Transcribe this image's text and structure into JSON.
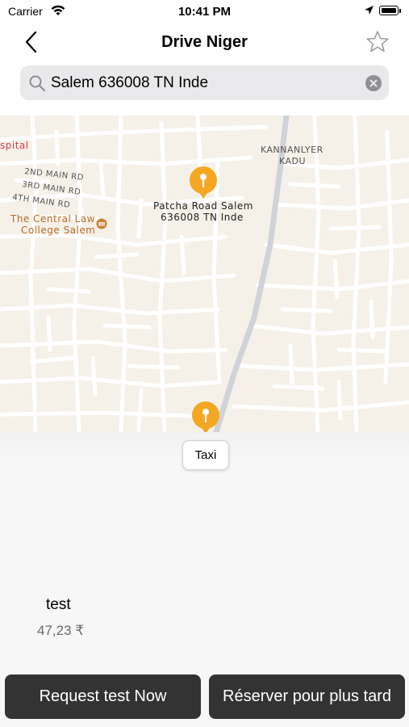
{
  "status_bar": {
    "carrier": "Carrier",
    "time": "10:41 PM"
  },
  "nav": {
    "title": "Drive Niger"
  },
  "search": {
    "value": "Salem 636008 TN Inde"
  },
  "map": {
    "labels": {
      "hospital": "spital",
      "main2": "2ND MAIN RD",
      "main3": "3RD MAIN RD",
      "main4": "4TH MAIN RD",
      "college_line1": "The Central Law",
      "college_line2": "College Salem",
      "area_line1": "KANNANLYER",
      "area_line2": "KADU",
      "pin_line1": "Patcha Road Salem",
      "pin_line2": "636008 TN Inde"
    },
    "colors": {
      "pin": "#f5a623",
      "road": "#ffffff",
      "land": "#f5f1e8",
      "highway": "#cfd2d6"
    }
  },
  "service": {
    "chip_label": "Taxi",
    "name": "test",
    "price": "47,23 ₹"
  },
  "actions": {
    "request_now": "Request test Now",
    "reserve_later": "Réserver pour plus tard"
  },
  "icons": [
    "wifi-icon",
    "location-arrow-icon",
    "battery-icon",
    "back-chevron-icon",
    "star-icon",
    "search-icon",
    "clear-icon",
    "map-pin-icon",
    "college-icon"
  ]
}
